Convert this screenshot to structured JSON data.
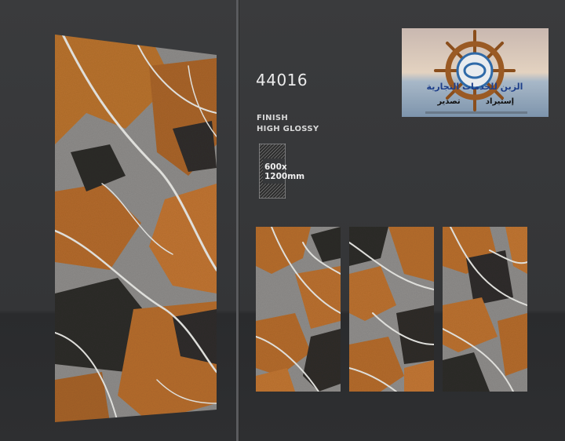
{
  "product": {
    "code": "44016",
    "finish_label": "FINISH",
    "finish_value": "HIGH GLOSSY",
    "size_line1": "600x",
    "size_line2": "1200mm"
  },
  "logo": {
    "text": "الزبن للخدمات التجارية",
    "subtext_right": "إستيراد",
    "subtext_left": "تصدير",
    "icon": "ship-wheel-icon"
  },
  "colors": {
    "background": "#363739",
    "marble_orange": "#b86a2a",
    "marble_grey": "#8d8c8b",
    "marble_dark": "#2c2a28",
    "vein": "#e6e6e2"
  }
}
